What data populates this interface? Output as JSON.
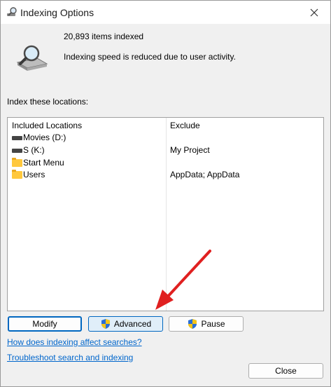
{
  "window": {
    "title": "Indexing Options"
  },
  "summary": {
    "items_indexed": "20,893 items indexed",
    "status": "Indexing speed is reduced due to user activity."
  },
  "locations": {
    "section_label": "Index these locations:",
    "headers": {
      "included": "Included Locations",
      "exclude": "Exclude"
    },
    "rows": [
      {
        "icon": "drive-icon",
        "name": "Movies (D:)",
        "exclude": ""
      },
      {
        "icon": "drive-icon",
        "name": "S (K:)",
        "exclude": "My Project"
      },
      {
        "icon": "folder-icon",
        "name": "Start Menu",
        "exclude": ""
      },
      {
        "icon": "folder-icon",
        "name": "Users",
        "exclude": "AppData; AppData"
      }
    ]
  },
  "buttons": {
    "modify": "Modify",
    "advanced": "Advanced",
    "pause": "Pause",
    "close": "Close"
  },
  "links": {
    "how_affects": "How does indexing affect searches?",
    "troubleshoot": "Troubleshoot search and indexing"
  },
  "colors": {
    "accent": "#0067c0",
    "link": "#0066cc",
    "annotation_arrow": "#e02020"
  }
}
